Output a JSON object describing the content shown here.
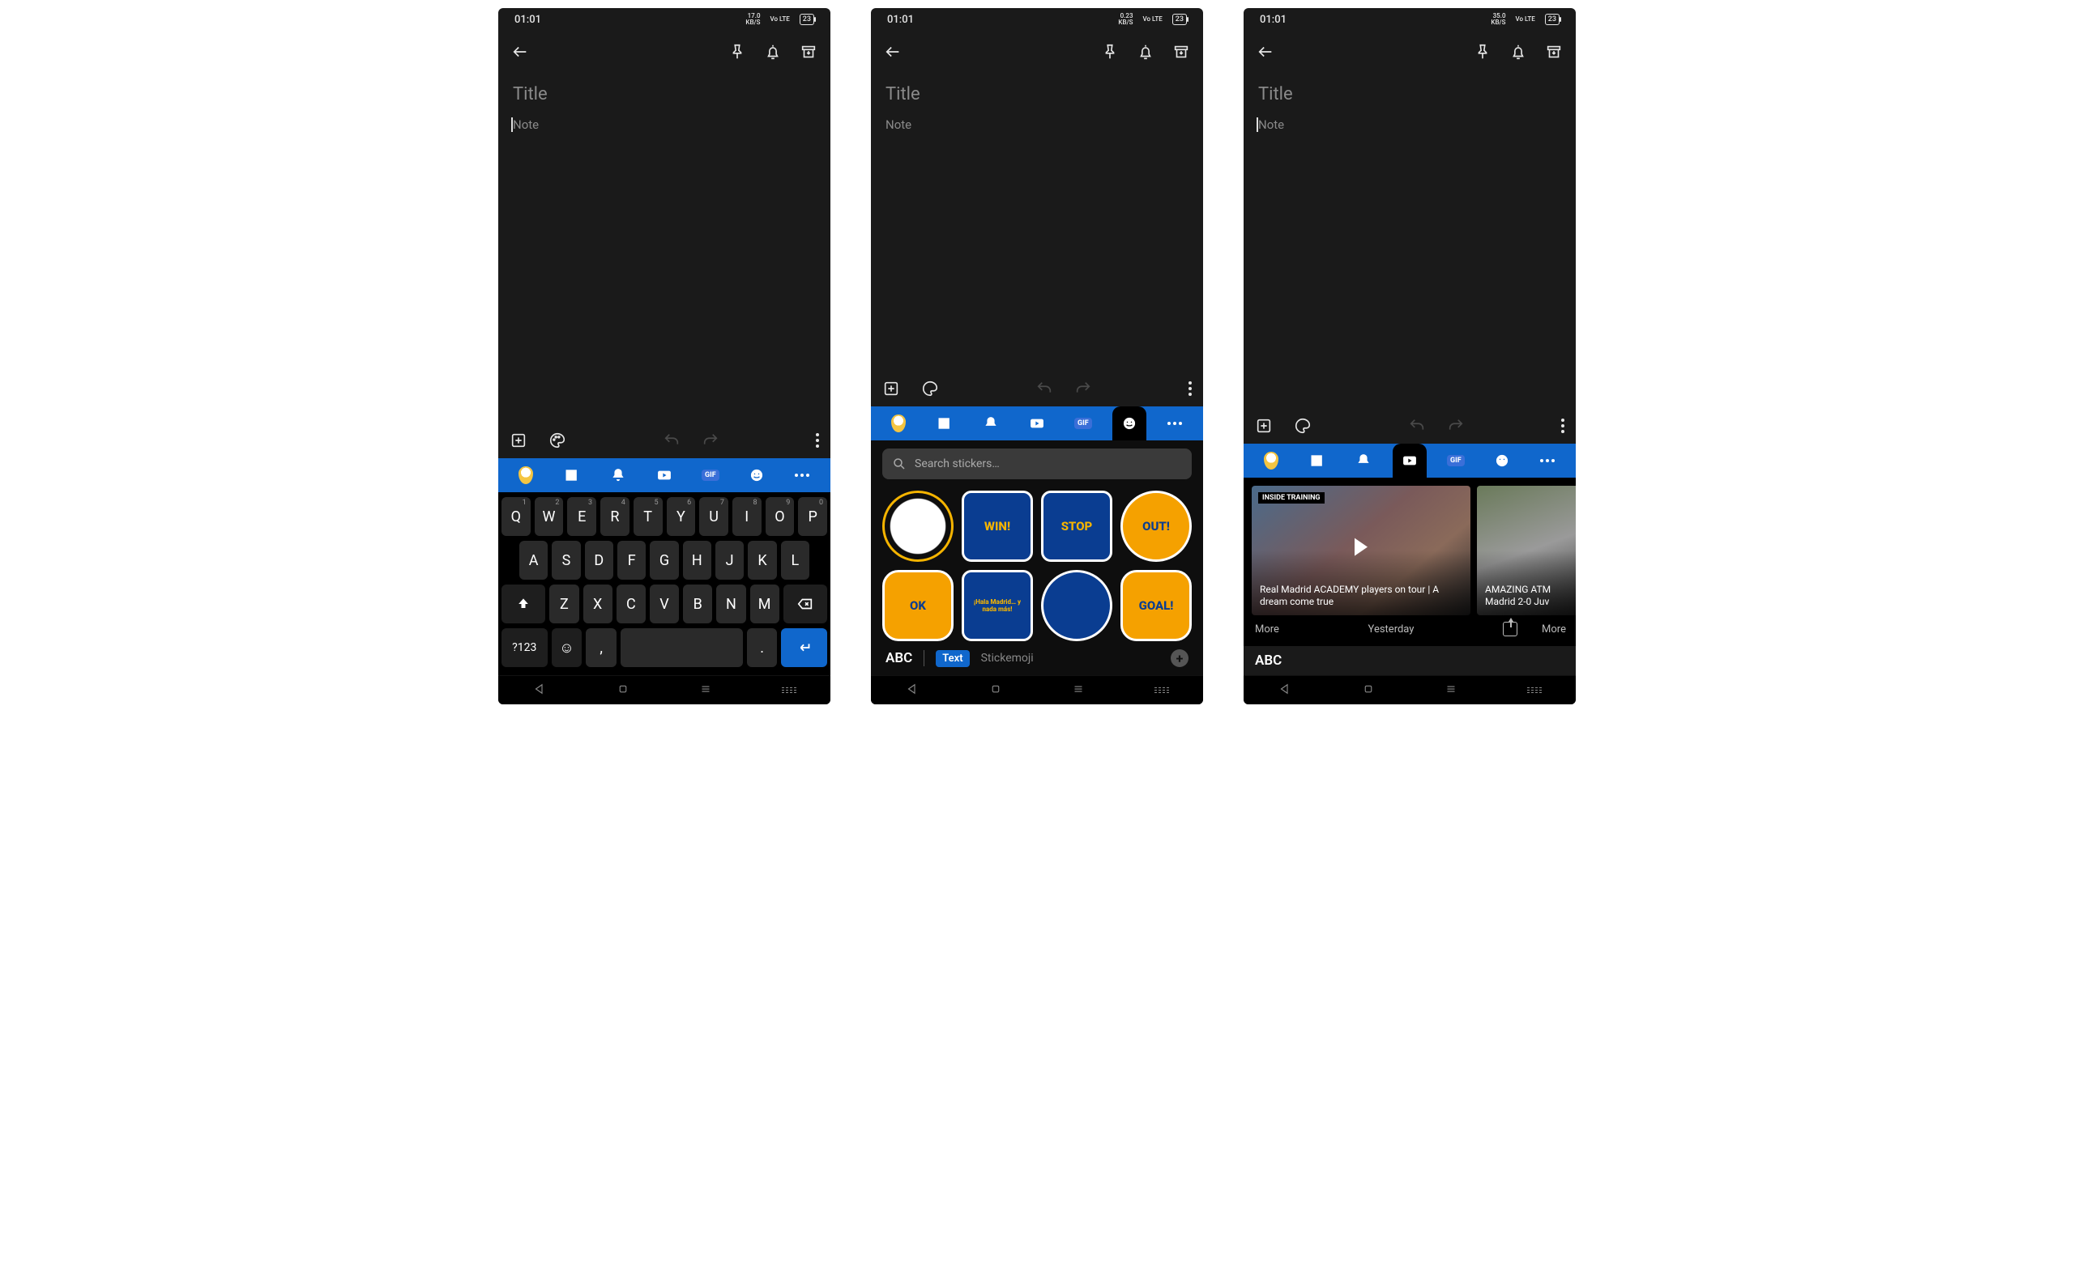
{
  "screens": [
    {
      "status": {
        "time": "01:01",
        "net": "17.0",
        "netUnit": "KB/S",
        "volte": "Vo LTE",
        "battery": "23"
      },
      "title_placeholder": "Title",
      "note_placeholder": "Note",
      "keyboard": {
        "row1": [
          {
            "k": "Q",
            "t": "1"
          },
          {
            "k": "W",
            "t": "2"
          },
          {
            "k": "E",
            "t": "3"
          },
          {
            "k": "R",
            "t": "4"
          },
          {
            "k": "T",
            "t": "5"
          },
          {
            "k": "Y",
            "t": "6"
          },
          {
            "k": "U",
            "t": "7"
          },
          {
            "k": "I",
            "t": "8"
          },
          {
            "k": "O",
            "t": "9"
          },
          {
            "k": "P",
            "t": "0"
          }
        ],
        "row2": [
          "A",
          "S",
          "D",
          "F",
          "G",
          "H",
          "J",
          "K",
          "L"
        ],
        "row3": [
          "Z",
          "X",
          "C",
          "V",
          "B",
          "N",
          "M"
        ],
        "symbols_label": "?123",
        "comma": ",",
        "period": "."
      }
    },
    {
      "status": {
        "time": "01:01",
        "net": "0.23",
        "netUnit": "KB/S",
        "volte": "Vo LTE",
        "battery": "23"
      },
      "title_placeholder": "Title",
      "note_placeholder": "Note",
      "search_placeholder": "Search stickers…",
      "stickers_row1": [
        "",
        "WIN!",
        "STOP",
        "OUT!"
      ],
      "stickers_row2": [
        "OK",
        "¡Hala Madrid… y nada más!",
        "",
        "GOAL!"
      ],
      "abc": "ABC",
      "text_chip": "Text",
      "stickemoji": "Stickemoji"
    },
    {
      "status": {
        "time": "01:01",
        "net": "35.0",
        "netUnit": "KB/S",
        "volte": "Vo LTE",
        "battery": "23"
      },
      "title_placeholder": "Title",
      "note_placeholder": "Note",
      "video1_tag": "INSIDE TRAINING",
      "video1_title": "Real Madrid ACADEMY players on tour | A dream come true",
      "video2_title": "AMAZING ATM Madrid 2-0 Juv",
      "more": "More",
      "yesterday": "Yesterday",
      "more2": "More",
      "abc": "ABC"
    }
  ]
}
